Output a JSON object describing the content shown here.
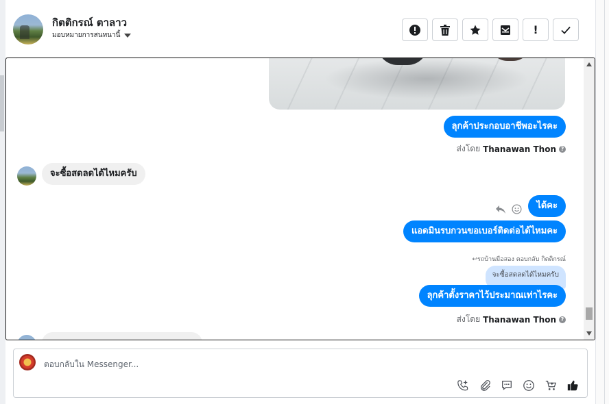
{
  "header": {
    "contact_name": "กิตติกรณ์ ตาลาว",
    "assign_label": "มอบหมายการสนทนานี้"
  },
  "toolbar": {
    "tools": [
      "alert-icon",
      "trash-icon",
      "star-icon",
      "archive-icon",
      "mark-spam-icon",
      "check-icon"
    ],
    "exclaim_label": "!"
  },
  "messages": {
    "m1_text": "ลุกค้าประกอบอาชีพอะไรคะ",
    "sentby_prefix": "ส่งโดย",
    "sentby_name": "Thanawan Thon",
    "m2_text": "จะซื้อสดลดได้ไหมครับ",
    "m3_text": "ได้คะ",
    "m4_text": "แอดมินรบกวนขอเบอร์ติดต่อได้ไหมคะ",
    "reply_hint": "↩รถบ้านมือสอง ตอบกลับ กิตติกรณ์",
    "quoted_text": "จะซื้อสดลดได้ไหมครับ",
    "m5_text": "ลุกค้าตั้งราคาไว้ประมาณเท่าไรคะ",
    "sentby2_prefix": "ส่งโดย",
    "sentby2_name": "Thanawan Thon"
  },
  "composer": {
    "placeholder": "ตอบกลับใน Messenger...",
    "icons": [
      "call-add-icon",
      "attachment-icon",
      "saved-reply-icon",
      "emoji-icon",
      "shop-icon",
      "like-icon"
    ]
  },
  "colors": {
    "outgoing_bubble": "#0084ff",
    "incoming_bubble": "#f0f0f0",
    "quoted_bubble": "#cfe4ff"
  }
}
